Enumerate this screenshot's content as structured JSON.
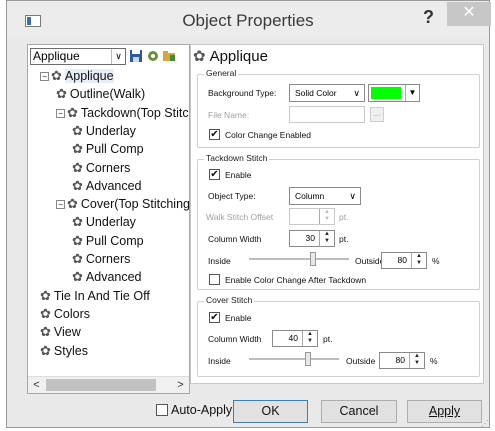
{
  "window": {
    "title": "Object Properties",
    "help_label": "?",
    "close_label": "✕"
  },
  "left": {
    "combo_value": "Applique",
    "tree": [
      {
        "label": "Applique",
        "level": 0,
        "expander": "−",
        "selected": true
      },
      {
        "label": "Outline(Walk)",
        "level": 1
      },
      {
        "label": "Tackdown(Top Stitc",
        "level": 1,
        "expander": "−"
      },
      {
        "label": "Underlay",
        "level": 2
      },
      {
        "label": "Pull Comp",
        "level": 2
      },
      {
        "label": "Corners",
        "level": 2
      },
      {
        "label": "Advanced",
        "level": 2
      },
      {
        "label": "Cover(Top Stitching",
        "level": 1,
        "expander": "−"
      },
      {
        "label": "Underlay",
        "level": 2
      },
      {
        "label": "Pull Comp",
        "level": 2
      },
      {
        "label": "Corners",
        "level": 2
      },
      {
        "label": "Advanced",
        "level": 2
      },
      {
        "label": "Tie In And Tie Off",
        "level": 0
      },
      {
        "label": "Colors",
        "level": 0
      },
      {
        "label": "View",
        "level": 0
      },
      {
        "label": "Styles",
        "level": 0
      }
    ],
    "scroll_left": "<",
    "scroll_right": ">"
  },
  "right": {
    "heading": "Applique",
    "general": {
      "title": "General",
      "bg_type_label": "Background Type:",
      "bg_type_value": "Solid Color",
      "color": "#00ff00",
      "file_name_label": "File Name:",
      "browse_label": "...",
      "color_change_label": "Color Change Enabled",
      "color_change_checked": true
    },
    "tackdown": {
      "title": "Tackdown Stitch",
      "enable_label": "Enable",
      "enable_checked": true,
      "object_type_label": "Object Type:",
      "object_type_value": "Column",
      "walk_offset_label": "Walk Stitch Offset",
      "walk_offset_unit": "pt.",
      "column_width_label": "Column Width",
      "column_width_value": "30",
      "column_width_unit": "pt.",
      "inside_label": "Inside",
      "outside_label": "Outside",
      "outside_value": "80",
      "outside_unit": "%",
      "color_change_after_label": "Enable Color Change After Tackdown",
      "color_change_after_checked": false
    },
    "cover": {
      "title": "Cover Stitch",
      "enable_label": "Enable",
      "enable_checked": true,
      "column_width_label": "Column Width",
      "column_width_value": "40",
      "column_width_unit": "pt.",
      "inside_label": "Inside",
      "outside_label": "Outside",
      "outside_value": "80",
      "outside_unit": "%"
    }
  },
  "footer": {
    "auto_apply_label": "Auto-Apply",
    "auto_apply_checked": false,
    "ok_label": "OK",
    "cancel_label": "Cancel",
    "apply_label": "Apply"
  },
  "icons": [
    "app-icon",
    "save-icon",
    "gear-icon",
    "folder-icon",
    "check-icon"
  ]
}
